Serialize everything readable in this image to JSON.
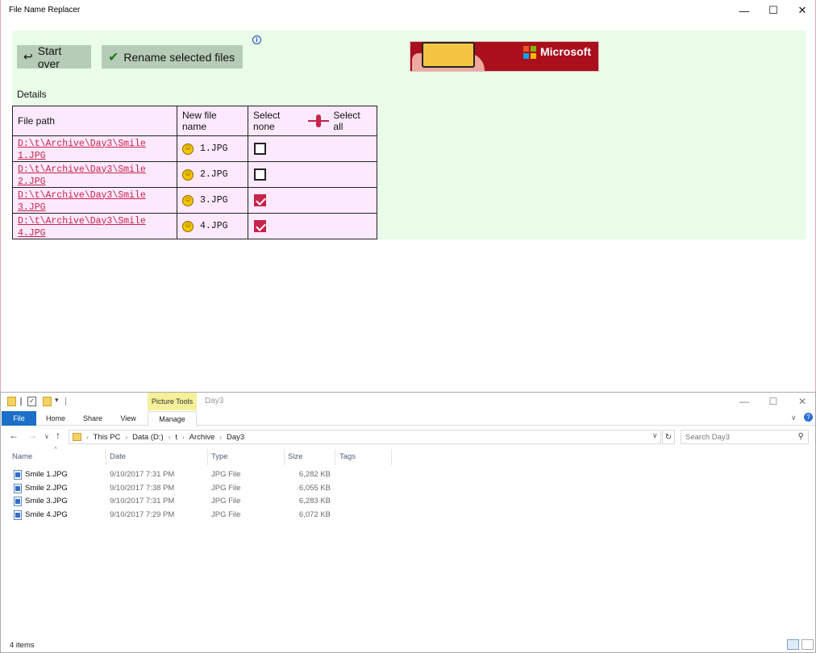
{
  "app": {
    "title": "File Name Replacer",
    "min_icon": "—",
    "max_icon": "☐",
    "close_icon": "✕",
    "start_over_label": "Start over",
    "start_over_icon": "↩",
    "rename_label": "Rename selected files",
    "rename_icon": "✔",
    "info_icon": "i",
    "ad_text": "Microsoft",
    "details_label": "Details",
    "table": {
      "headers": {
        "file_path": "File path",
        "new_file_name": "New file name",
        "select_none": "Select none",
        "select_all": "Select all"
      },
      "rows": [
        {
          "path": "D:\\t\\Archive\\Day3\\Smile 1.JPG",
          "new_name": "1.JPG",
          "selected": false
        },
        {
          "path": "D:\\t\\Archive\\Day3\\Smile 2.JPG",
          "new_name": "2.JPG",
          "selected": false
        },
        {
          "path": "D:\\t\\Archive\\Day3\\Smile 3.JPG",
          "new_name": "3.JPG",
          "selected": true
        },
        {
          "path": "D:\\t\\Archive\\Day3\\Smile 4.JPG",
          "new_name": "4.JPG",
          "selected": true
        }
      ]
    },
    "colors": {
      "accent": "#c8234a",
      "panel_green": "#e9fde9",
      "table_pink": "#fde9fd",
      "button_green": "#b7ccb7"
    }
  },
  "explorer": {
    "title": "Day3",
    "contextual_tab": "Picture Tools",
    "min_icon": "—",
    "max_icon": "☐",
    "close_icon": "✕",
    "ribbon_tabs": {
      "file": "File",
      "home": "Home",
      "share": "Share",
      "view": "View",
      "manage": "Manage"
    },
    "breadcrumb": [
      "This PC",
      "Data (D:)",
      "t",
      "Archive",
      "Day3"
    ],
    "search_placeholder": "Search Day3",
    "columns": {
      "name": "Name",
      "date": "Date",
      "type": "Type",
      "size": "Size",
      "tags": "Tags"
    },
    "files": [
      {
        "name": "Smile 1.JPG",
        "date": "9/10/2017 7:31 PM",
        "type": "JPG File",
        "size": "6,282 KB"
      },
      {
        "name": "Smile 2.JPG",
        "date": "9/10/2017 7:38 PM",
        "type": "JPG File",
        "size": "6,055 KB"
      },
      {
        "name": "Smile 3.JPG",
        "date": "9/10/2017 7:31 PM",
        "type": "JPG File",
        "size": "6,283 KB"
      },
      {
        "name": "Smile 4.JPG",
        "date": "9/10/2017 7:29 PM",
        "type": "JPG File",
        "size": "6,072 KB"
      }
    ],
    "status": "4 items",
    "icons": {
      "back": "←",
      "forward": "→",
      "recent": "∨",
      "up": "↑",
      "refresh": "↻",
      "search": "⚲",
      "sort": "^",
      "expand_ribbon": "∨",
      "help": "?"
    }
  }
}
